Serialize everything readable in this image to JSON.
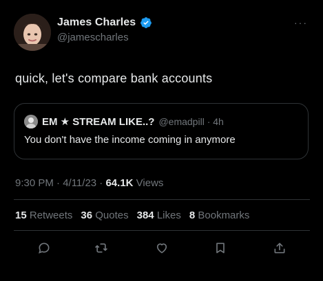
{
  "author": {
    "display_name": "James Charles",
    "handle": "@jamescharles",
    "verified_icon": "verified-badge-icon",
    "accent_color": "#1d9bf0"
  },
  "tweet": {
    "text": "quick, let's compare bank accounts"
  },
  "quote": {
    "display_name": "EM ★ STREAM LIKE..?",
    "handle_time": "@emadpill · 4h",
    "text": "You don't have the income coming in anymore"
  },
  "meta": {
    "datetime": "9:30 PM · 4/11/23 · ",
    "views_count": "64.1K",
    "views_label": " Views"
  },
  "stats": {
    "retweets": {
      "count": "15",
      "label": "Retweets"
    },
    "quotes": {
      "count": "36",
      "label": "Quotes"
    },
    "likes": {
      "count": "384",
      "label": "Likes"
    },
    "bookmarks": {
      "count": "8",
      "label": "Bookmarks"
    }
  },
  "actions": {
    "icons": [
      "reply-icon",
      "retweet-icon",
      "like-icon",
      "bookmark-icon",
      "share-icon"
    ]
  },
  "colors": {
    "background": "#000000",
    "text_primary": "#e7e9ea",
    "text_secondary": "#71767b",
    "border": "#2f3336"
  }
}
